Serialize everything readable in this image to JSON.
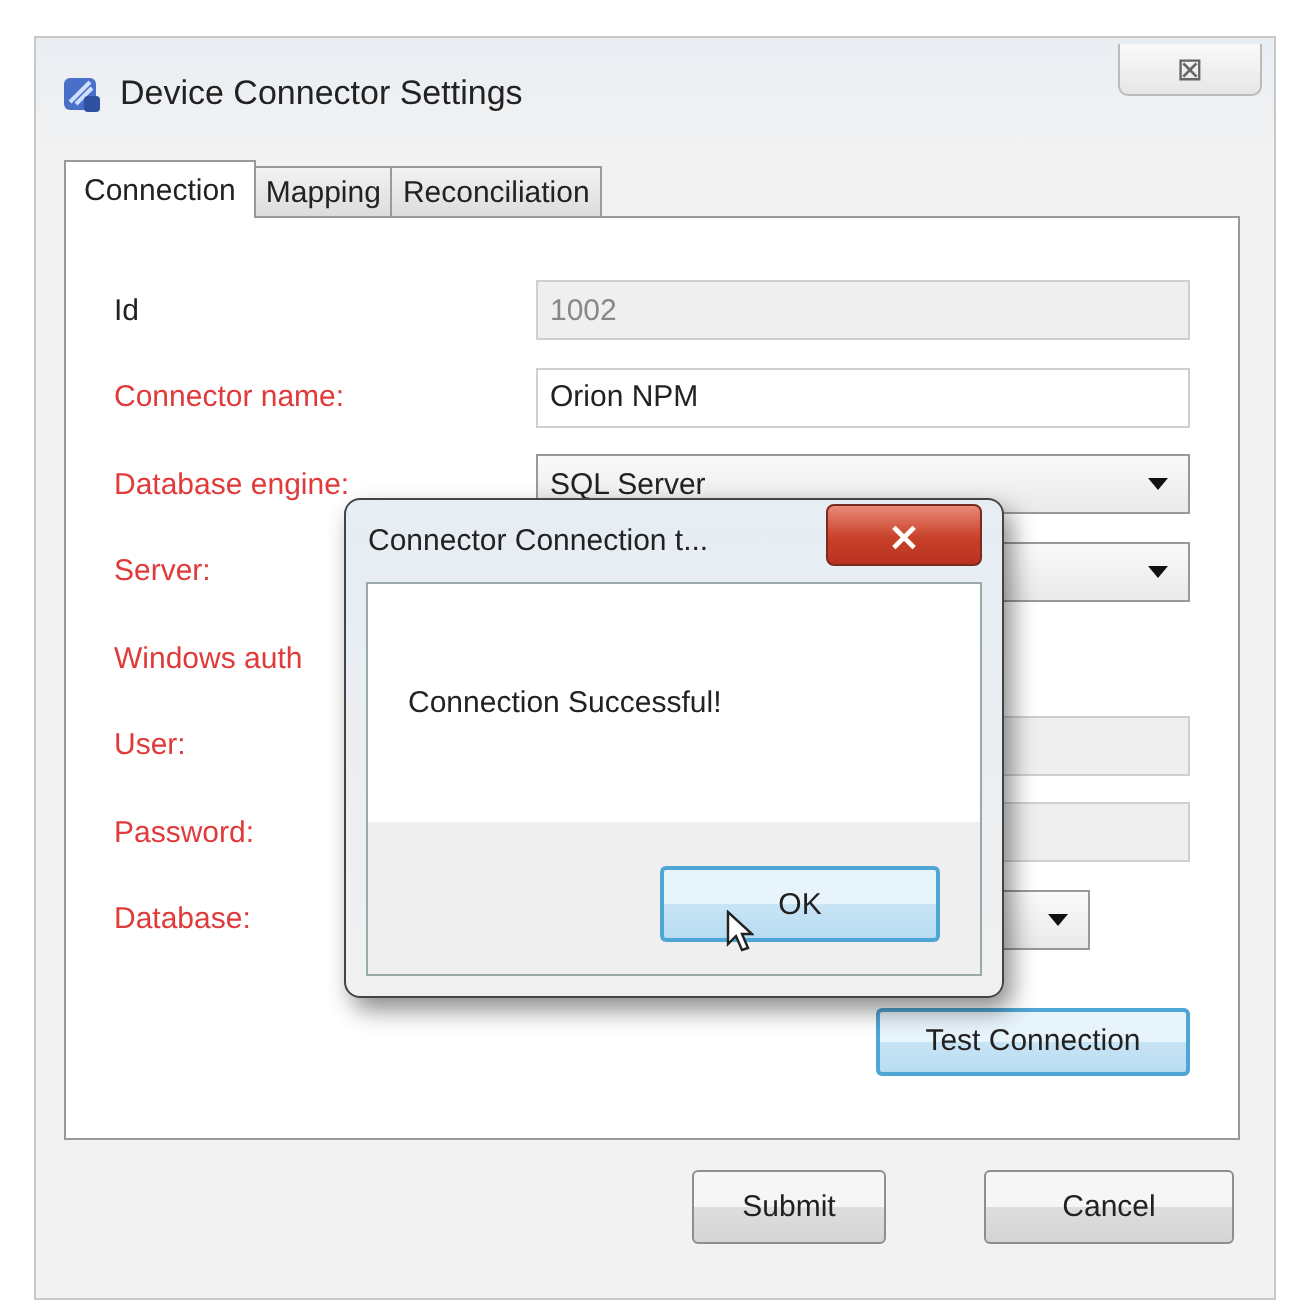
{
  "window": {
    "title": "Device Connector Settings",
    "close": "⊠"
  },
  "tabs": [
    {
      "label": "Connection",
      "selected": true
    },
    {
      "label": "Mapping",
      "selected": false
    },
    {
      "label": "Reconciliation",
      "selected": false
    }
  ],
  "fields": [
    {
      "label": "Id",
      "kind": "text",
      "value": "1002",
      "required": false,
      "disabled": true
    },
    {
      "label": "Connector name:",
      "kind": "text",
      "value": "Orion NPM",
      "required": true,
      "disabled": false
    },
    {
      "label": "Database engine:",
      "kind": "dropdown",
      "value": "SQL Server",
      "required": true,
      "disabled": false
    },
    {
      "label": "Server:",
      "kind": "dropdown",
      "required": true,
      "disabled": false
    },
    {
      "label": "Windows auth",
      "kind": "label",
      "required": true
    },
    {
      "label": "User:",
      "kind": "text",
      "required": true,
      "disabled": true
    },
    {
      "label": "Password:",
      "kind": "text",
      "required": true,
      "disabled": true
    },
    {
      "label": "Database:",
      "kind": "short-dropdown",
      "required": true,
      "disabled": false
    }
  ],
  "test_button": {
    "label": "Test Connection",
    "focused": true
  },
  "buttons": [
    {
      "label": "Submit",
      "focused": false
    },
    {
      "label": "Cancel",
      "focused": false
    }
  ],
  "dialog": {
    "title": "Connector Connection t...",
    "close": "×",
    "message": "Connection Successful!",
    "button": {
      "label": "OK",
      "focused": true
    }
  }
}
